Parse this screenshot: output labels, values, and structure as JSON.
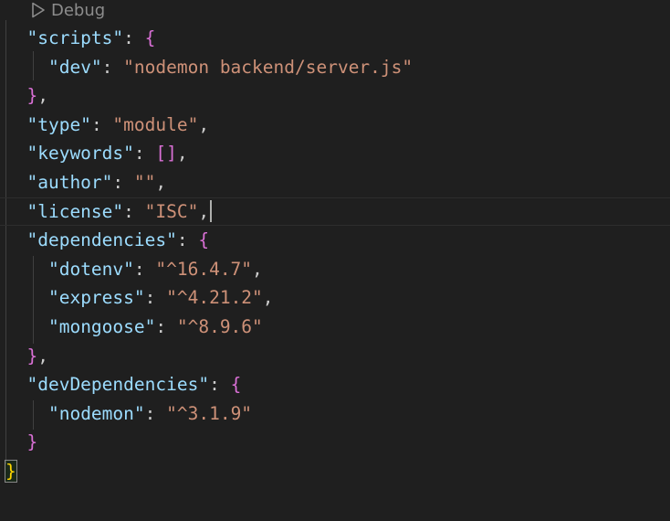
{
  "codelens": {
    "label": "Debug",
    "icon": "play-outline-icon"
  },
  "colors": {
    "background": "#1f1f1f",
    "key": "#9cdcfe",
    "string": "#ce9178",
    "punctuation": "#cccccc",
    "bracket_depth1": "#da70d6",
    "bracket_depth0": "#ffd700"
  },
  "lines": [
    [
      {
        "t": "  "
      },
      {
        "k": "\"scripts\""
      },
      {
        "p": ": "
      },
      {
        "b": "{"
      }
    ],
    [
      {
        "t": "    "
      },
      {
        "k": "\"dev\""
      },
      {
        "p": ": "
      },
      {
        "s": "\"nodemon backend/server.js\""
      }
    ],
    [
      {
        "t": "  "
      },
      {
        "b": "}"
      },
      {
        "p": ","
      }
    ],
    [
      {
        "t": "  "
      },
      {
        "k": "\"type\""
      },
      {
        "p": ": "
      },
      {
        "s": "\"module\""
      },
      {
        "p": ","
      }
    ],
    [
      {
        "t": "  "
      },
      {
        "k": "\"keywords\""
      },
      {
        "p": ": "
      },
      {
        "b": "[]"
      },
      {
        "p": ","
      }
    ],
    [
      {
        "t": "  "
      },
      {
        "k": "\"author\""
      },
      {
        "p": ": "
      },
      {
        "s": "\"\""
      },
      {
        "p": ","
      }
    ],
    [
      {
        "t": "  "
      },
      {
        "k": "\"license\""
      },
      {
        "p": ": "
      },
      {
        "s": "\"ISC\""
      },
      {
        "p": ","
      }
    ],
    [
      {
        "t": "  "
      },
      {
        "k": "\"dependencies\""
      },
      {
        "p": ": "
      },
      {
        "b": "{"
      }
    ],
    [
      {
        "t": "    "
      },
      {
        "k": "\"dotenv\""
      },
      {
        "p": ": "
      },
      {
        "s": "\"^16.4.7\""
      },
      {
        "p": ","
      }
    ],
    [
      {
        "t": "    "
      },
      {
        "k": "\"express\""
      },
      {
        "p": ": "
      },
      {
        "s": "\"^4.21.2\""
      },
      {
        "p": ","
      }
    ],
    [
      {
        "t": "    "
      },
      {
        "k": "\"mongoose\""
      },
      {
        "p": ": "
      },
      {
        "s": "\"^8.9.6\""
      }
    ],
    [
      {
        "t": "  "
      },
      {
        "b": "}"
      },
      {
        "p": ","
      }
    ],
    [
      {
        "t": "  "
      },
      {
        "k": "\"devDependencies\""
      },
      {
        "p": ": "
      },
      {
        "b": "{"
      }
    ],
    [
      {
        "t": "    "
      },
      {
        "k": "\"nodemon\""
      },
      {
        "p": ": "
      },
      {
        "s": "\"^3.1.9\""
      }
    ],
    [
      {
        "t": "  "
      },
      {
        "b": "}"
      }
    ],
    [
      {
        "r": "}"
      }
    ]
  ],
  "cursor_line": 6
}
